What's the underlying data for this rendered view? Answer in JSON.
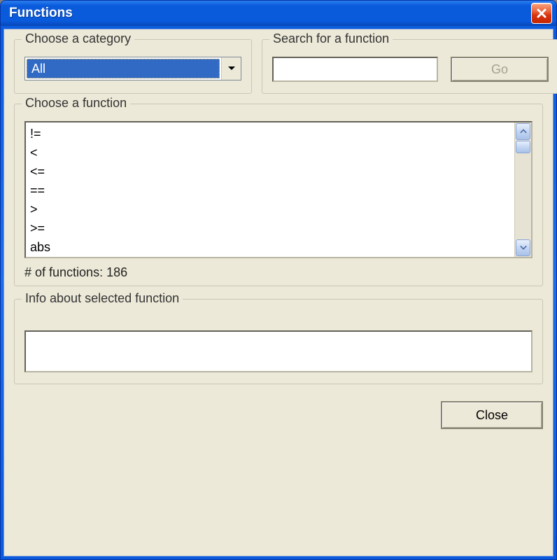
{
  "window": {
    "title": "Functions"
  },
  "category": {
    "legend": "Choose a category",
    "selected": "All"
  },
  "search": {
    "legend": "Search for a function",
    "value": "",
    "go_label": "Go"
  },
  "functions": {
    "legend": "Choose a function",
    "items": [
      "!=",
      "<",
      "<=",
      "==",
      ">",
      ">=",
      "abs"
    ],
    "count_prefix": "# of functions: ",
    "count": "186"
  },
  "info": {
    "legend": "Info about selected function",
    "text": ""
  },
  "buttons": {
    "close": "Close"
  }
}
